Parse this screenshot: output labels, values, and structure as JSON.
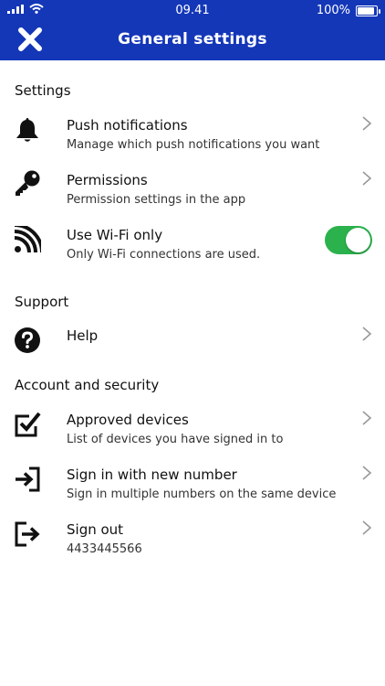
{
  "status_bar": {
    "time": "09.41",
    "battery": "100%",
    "battery_level": 1.0
  },
  "header": {
    "title": "General settings"
  },
  "sections": {
    "settings": "Settings",
    "support": "Support",
    "account": "Account and security"
  },
  "items": {
    "push": {
      "label": "Push notifications",
      "sub": "Manage which push notifications you want"
    },
    "permissions": {
      "label": "Permissions",
      "sub": "Permission settings in the app"
    },
    "wifi": {
      "label": "Use Wi-Fi only",
      "sub": "Only Wi-Fi connections are used.",
      "enabled": true
    },
    "help": {
      "label": "Help"
    },
    "devices": {
      "label": "Approved devices",
      "sub": "List of devices you have signed in to"
    },
    "new_number": {
      "label": "Sign in with new number",
      "sub": "Sign in multiple numbers on the same device"
    },
    "signout": {
      "label": "Sign out",
      "sub": "4433445566"
    }
  },
  "colors": {
    "header_bg": "#1437b8",
    "toggle_on": "#2bb24c"
  },
  "icons": [
    "close-icon",
    "bell-icon",
    "key-icon",
    "wifi-feed-icon",
    "help-icon",
    "checkbox-icon",
    "sign-in-icon",
    "sign-out-icon",
    "chevron-right-icon"
  ]
}
